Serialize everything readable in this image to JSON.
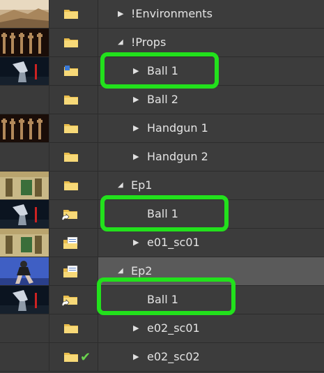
{
  "tree": {
    "rows": [
      {
        "label": "!Environments",
        "thumbnail": "environment-thumbnail",
        "icon": "folder-icon",
        "toggle": "collapsed"
      },
      {
        "label": "!Props",
        "thumbnail": "props-thumbnail",
        "icon": "folder-icon",
        "toggle": "expanded"
      },
      {
        "label": "Ball 1",
        "thumbnail": "ball-thumbnail",
        "icon": "asset-folder-icon",
        "toggle": "collapsed",
        "highlighted": true
      },
      {
        "label": "Ball 2",
        "thumbnail": "",
        "icon": "folder-icon",
        "toggle": "collapsed"
      },
      {
        "label": "Handgun 1",
        "thumbnail": "handgun-thumbnail",
        "icon": "folder-icon",
        "toggle": "collapsed"
      },
      {
        "label": "Handgun 2",
        "thumbnail": "",
        "icon": "folder-icon",
        "toggle": "collapsed"
      },
      {
        "label": "Ep1",
        "thumbnail": "episode-thumbnail",
        "icon": "folder-icon",
        "toggle": "expanded"
      },
      {
        "label": "Ball 1",
        "thumbnail": "ball-thumbnail",
        "icon": "linked-folder-icon",
        "toggle": "none",
        "highlighted": true
      },
      {
        "label": "e01_sc01",
        "thumbnail": "episode-thumbnail",
        "icon": "document-folder-icon",
        "toggle": "collapsed"
      },
      {
        "label": "Ep2",
        "thumbnail": "character-thumbnail",
        "icon": "document-folder-icon",
        "toggle": "expanded",
        "selected": true
      },
      {
        "label": "Ball 1",
        "thumbnail": "ball-thumbnail",
        "icon": "linked-folder-icon",
        "toggle": "none",
        "highlighted": true
      },
      {
        "label": "e02_sc01",
        "thumbnail": "",
        "icon": "folder-icon",
        "toggle": "collapsed"
      },
      {
        "label": "e02_sc02",
        "thumbnail": "",
        "icon": "folder-icon",
        "toggle": "collapsed",
        "status": "check-icon"
      }
    ]
  },
  "colors": {
    "background": "#3c3c3c",
    "selected_row": "#565656",
    "highlight": "#22e11c",
    "folder": "#f2cd61",
    "check": "#6ad34e"
  }
}
